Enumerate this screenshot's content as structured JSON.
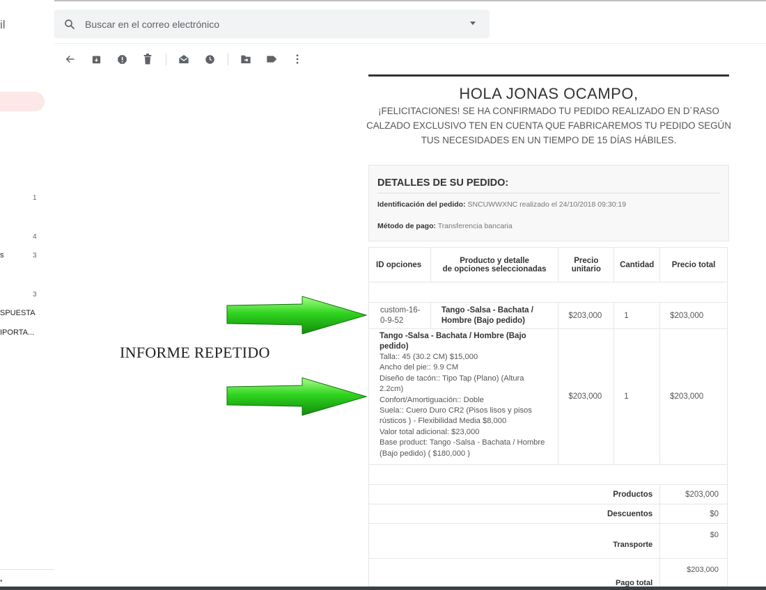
{
  "app": {
    "logo_fragment": "il"
  },
  "search": {
    "placeholder": "Buscar en el correo electrónico"
  },
  "sidebar": {
    "counts": [
      "1",
      "4",
      "3",
      "3"
    ],
    "labels": [
      "s",
      "SPUESTA",
      "IPORTA..."
    ]
  },
  "annotation": {
    "text": "INFORME REPETIDO"
  },
  "email": {
    "greeting": "HOLA JONAS OCAMPO,",
    "congrats": "¡FELICITACIONES! SE HA CONFIRMADO TU PEDIDO REALIZADO EN  D´RASO CALZADO EXCLUSIVO TEN EN CUENTA QUE FABRICAREMOS TU PEDIDO SEGÚN TUS NECESIDADES EN UN TIEMPO DE 15 DÍAS HÁBILES.",
    "details_title": "DETALLES DE SU PEDIDO:",
    "order_id_label": "Identificación del pedido:",
    "order_id_value": "SNCUWWXNC realizado el 24/10/2018 09:30:19",
    "payment_label": "Método de pago:",
    "payment_value": "Transferencia bancaria",
    "table": {
      "headers": {
        "id": "ID opciones",
        "product_1": "Producto y detalle",
        "product_2": "de opciones seleccionadas",
        "unit_1": "Precio",
        "unit_2": "unitario",
        "qty": "Cantidad",
        "total": "Precio total"
      },
      "row1": {
        "id_1": "custom-16-",
        "id_2": "0-9-52",
        "product_1": "Tango -Salsa - Bachata /",
        "product_2": "Hombre (Bajo pedido)",
        "unit": "$203,000",
        "qty": "1",
        "total": "$203,000"
      },
      "row2": {
        "title_1": "Tango -Salsa - Bachata / Hombre (Bajo",
        "title_2": "pedido)",
        "lines": [
          "Talla:: 45 (30.2 CM) $15,000",
          "Ancho del pie:: 9.9 CM",
          "Diseño de tacón:: Tipo Tap (Plano) (Altura",
          "2.2cm)",
          "Confort/Amortiguación:: Doble",
          "Suela:: Cuero Duro CR2 (Pisos lisos y pisos",
          "rústicos ) - Flexibilidad Media $8,000",
          "Valor total adicional: $23,000",
          "Base product: Tango -Salsa - Bachata / Hombre",
          "(Bajo pedido) ( $180,000 )"
        ],
        "unit": "$203,000",
        "qty": "1",
        "total": "$203,000"
      },
      "summary": {
        "products_label": "Productos",
        "products_value": "$203,000",
        "discounts_label": "Descuentos",
        "discounts_value": "$0",
        "shipping_label": "Transporte",
        "shipping_value": "$0",
        "total_label": "Pago total",
        "total_value": "$203,000"
      }
    }
  },
  "colors": {
    "accent_pill": "#fce8e6",
    "arrow_green": "#2ecc1f",
    "search_bg": "#f1f3f4"
  }
}
